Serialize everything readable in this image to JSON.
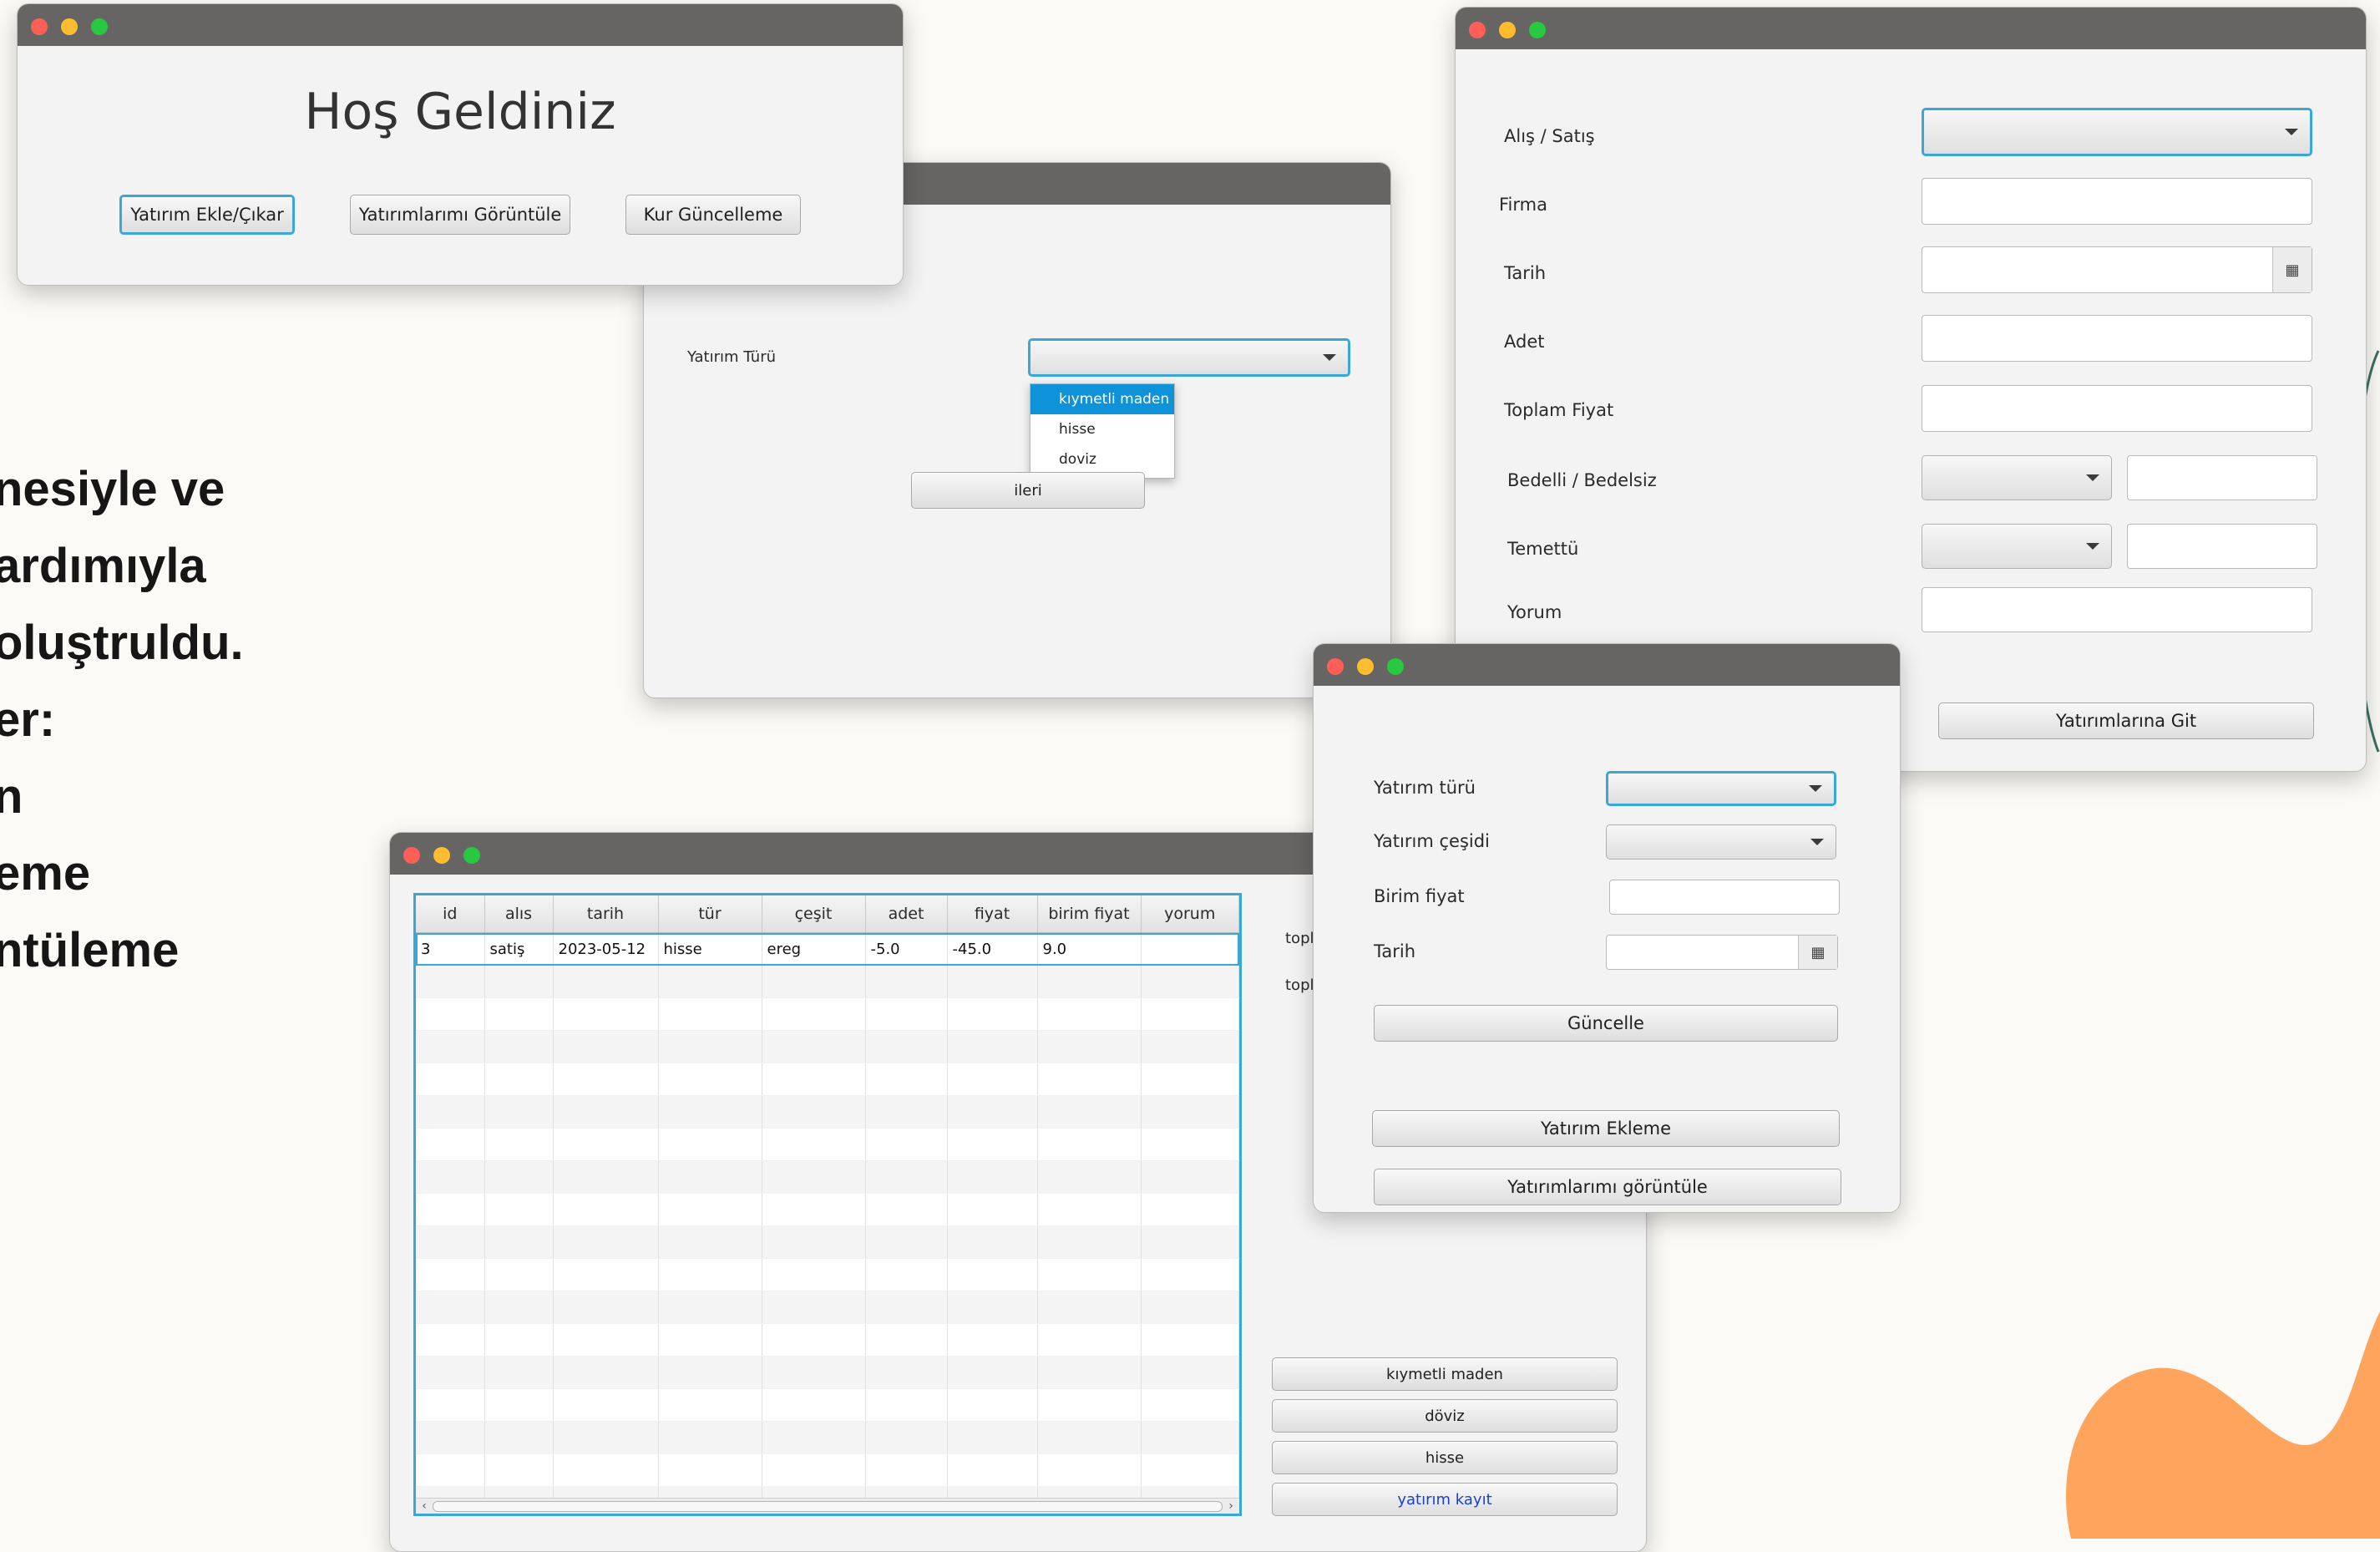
{
  "background_text": [
    "nesiyle ve",
    "ardımıyla",
    "oluştruldu.",
    "er:",
    "n",
    "eme",
    "ntüleme"
  ],
  "colors": {
    "accent": "#3aa7d8",
    "selection": "#0e93d8",
    "blob": "#ffa45c",
    "titlebar": "#666563"
  },
  "welcome_window": {
    "title": "Hoş Geldiniz",
    "buttons": [
      "Yatırım Ekle/Çıkar",
      "Yatırımlarımı Görüntüle",
      "Kur Güncelleme"
    ]
  },
  "type_window": {
    "label": "Yatırım Türü",
    "options": [
      "kıymetli maden",
      "hisse",
      "doviz"
    ],
    "next_button": "ileri"
  },
  "form_window": {
    "labels": {
      "alis_satis": "Alış / Satış",
      "firma": "Firma",
      "tarih": "Tarih",
      "adet": "Adet",
      "toplam_fiyat": "Toplam Fiyat",
      "bedelli": "Bedelli / Bedelsiz",
      "temettu": "Temettü",
      "yorum": "Yorum"
    },
    "go_button": "Yatırımlarına Git"
  },
  "table_window": {
    "columns": [
      "id",
      "alıs",
      "tarih",
      "tür",
      "çeşit",
      "adet",
      "fiyat",
      "birim fiyat",
      "yorum"
    ],
    "rows": [
      [
        "3",
        "satiş",
        "2023-05-12",
        "hisse",
        "ereg",
        "-5.0",
        "-45.0",
        "9.0",
        ""
      ]
    ],
    "side_label_1": "topl",
    "side_label_2": "topl",
    "buttons": [
      "kıymetli maden",
      "döviz",
      "hisse"
    ],
    "save_button": "yatırım kayıt"
  },
  "update_window": {
    "labels": {
      "tur": "Yatırım türü",
      "cesit": "Yatırım çeşidi",
      "birim_fiyat": "Birim fiyat",
      "tarih": "Tarih"
    },
    "update_button": "Güncelle",
    "add_button": "Yatırım Ekleme",
    "view_button": "Yatırımlarımı görüntüle"
  }
}
